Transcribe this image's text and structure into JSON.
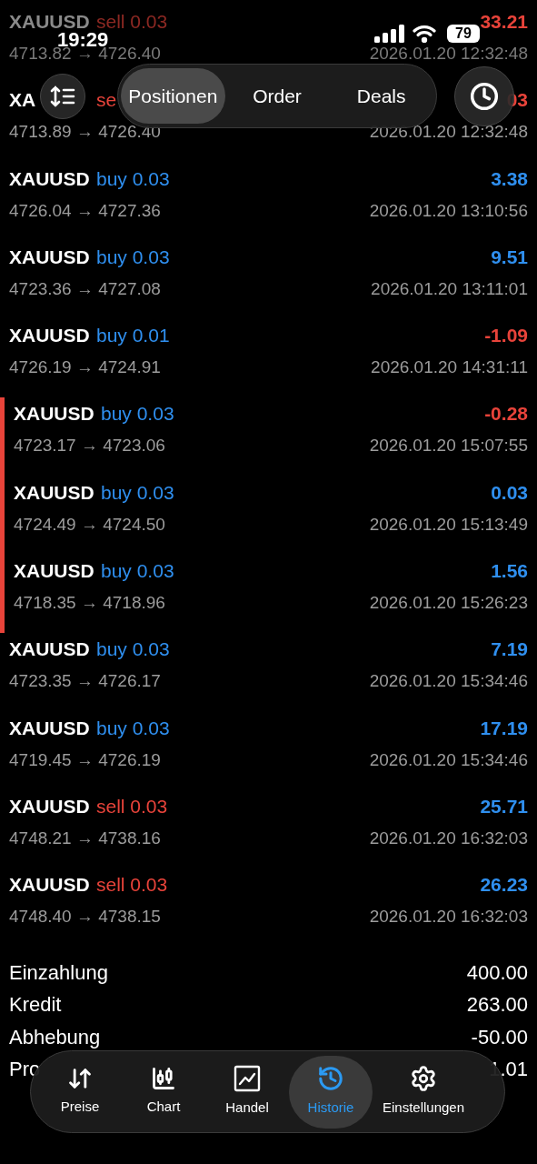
{
  "status_bar": {
    "time": "19:29",
    "battery": "79"
  },
  "segments": [
    {
      "label": "Positionen",
      "selected": true
    },
    {
      "label": "Order",
      "selected": false
    },
    {
      "label": "Deals",
      "selected": false
    }
  ],
  "deals": [
    {
      "symbol": "XAUUSD",
      "side": "sell",
      "volume": "0.03",
      "prices": "4713.82 → 4726.40",
      "time": "2026.01.20 12:32:48",
      "profit": "33.21",
      "color": "#e8433a",
      "highlighted": false,
      "faded": true
    },
    {
      "symbol": "XA",
      "side": "se",
      "prices": "4713.89 → 4726.40",
      "time": "2026.01.20 12:32:48",
      "profit": "03",
      "color": "#e8433a",
      "highlighted": false,
      "faded": false
    },
    {
      "symbol": "XAUUSD",
      "side": "buy",
      "volume": "0.03",
      "prices": "4726.04 → 4727.36",
      "time": "2026.01.20 13:10:56",
      "profit": "3.38",
      "color": "#2f8fef",
      "highlighted": false,
      "faded": false
    },
    {
      "symbol": "XAUUSD",
      "side": "buy",
      "volume": "0.03",
      "prices": "4723.36 → 4727.08",
      "time": "2026.01.20 13:11:01",
      "profit": "9.51",
      "color": "#2f8fef",
      "highlighted": false,
      "faded": false
    },
    {
      "symbol": "XAUUSD",
      "side": "buy",
      "volume": "0.01",
      "prices": "4726.19 → 4724.91",
      "time": "2026.01.20 14:31:11",
      "profit": "-1.09",
      "color": "#e8433a",
      "highlighted": false,
      "faded": false
    },
    {
      "symbol": "XAUUSD",
      "side": "buy",
      "volume": "0.03",
      "prices": "4723.17 → 4723.06",
      "time": "2026.01.20 15:07:55",
      "profit": "-0.28",
      "color": "#e8433a",
      "highlighted": true,
      "faded": false
    },
    {
      "symbol": "XAUUSD",
      "side": "buy",
      "volume": "0.03",
      "prices": "4724.49 → 4724.50",
      "time": "2026.01.20 15:13:49",
      "profit": "0.03",
      "color": "#2f8fef",
      "highlighted": true,
      "faded": false
    },
    {
      "symbol": "XAUUSD",
      "side": "buy",
      "volume": "0.03",
      "prices": "4718.35 → 4718.96",
      "time": "2026.01.20 15:26:23",
      "profit": "1.56",
      "color": "#2f8fef",
      "highlighted": true,
      "faded": false
    },
    {
      "symbol": "XAUUSD",
      "side": "buy",
      "volume": "0.03",
      "prices": "4723.35 → 4726.17",
      "time": "2026.01.20 15:34:46",
      "profit": "7.19",
      "color": "#2f8fef",
      "highlighted": false,
      "faded": false
    },
    {
      "symbol": "XAUUSD",
      "side": "buy",
      "volume": "0.03",
      "prices": "4719.45 → 4726.19",
      "time": "2026.01.20 15:34:46",
      "profit": "17.19",
      "color": "#2f8fef",
      "highlighted": false,
      "faded": false
    },
    {
      "symbol": "XAUUSD",
      "side": "sell",
      "volume": "0.03",
      "prices": "4748.21 → 4738.16",
      "time": "2026.01.20 16:32:03",
      "profit": "25.71",
      "color": "#2f8fef",
      "highlighted": false,
      "faded": false
    },
    {
      "symbol": "XAUUSD",
      "side": "sell",
      "volume": "0.03",
      "prices": "4748.40 → 4738.15",
      "time": "2026.01.20 16:32:03",
      "profit": "26.23",
      "color": "#2f8fef",
      "highlighted": false,
      "faded": false
    }
  ],
  "summary": [
    {
      "label": "Einzahlung",
      "value": "400.00",
      "faded": false
    },
    {
      "label": "Kredit",
      "value": "263.00",
      "faded": false
    },
    {
      "label": "Abhebung",
      "value": "-50.00",
      "faded": false
    },
    {
      "label": "Pro",
      "value": "1.01",
      "faded": false
    }
  ],
  "nav": [
    {
      "label": "Preise",
      "selected": false
    },
    {
      "label": "Chart",
      "selected": false
    },
    {
      "label": "Handel",
      "selected": false
    },
    {
      "label": "Historie",
      "selected": true
    },
    {
      "label": "Einstellungen",
      "selected": false
    }
  ]
}
